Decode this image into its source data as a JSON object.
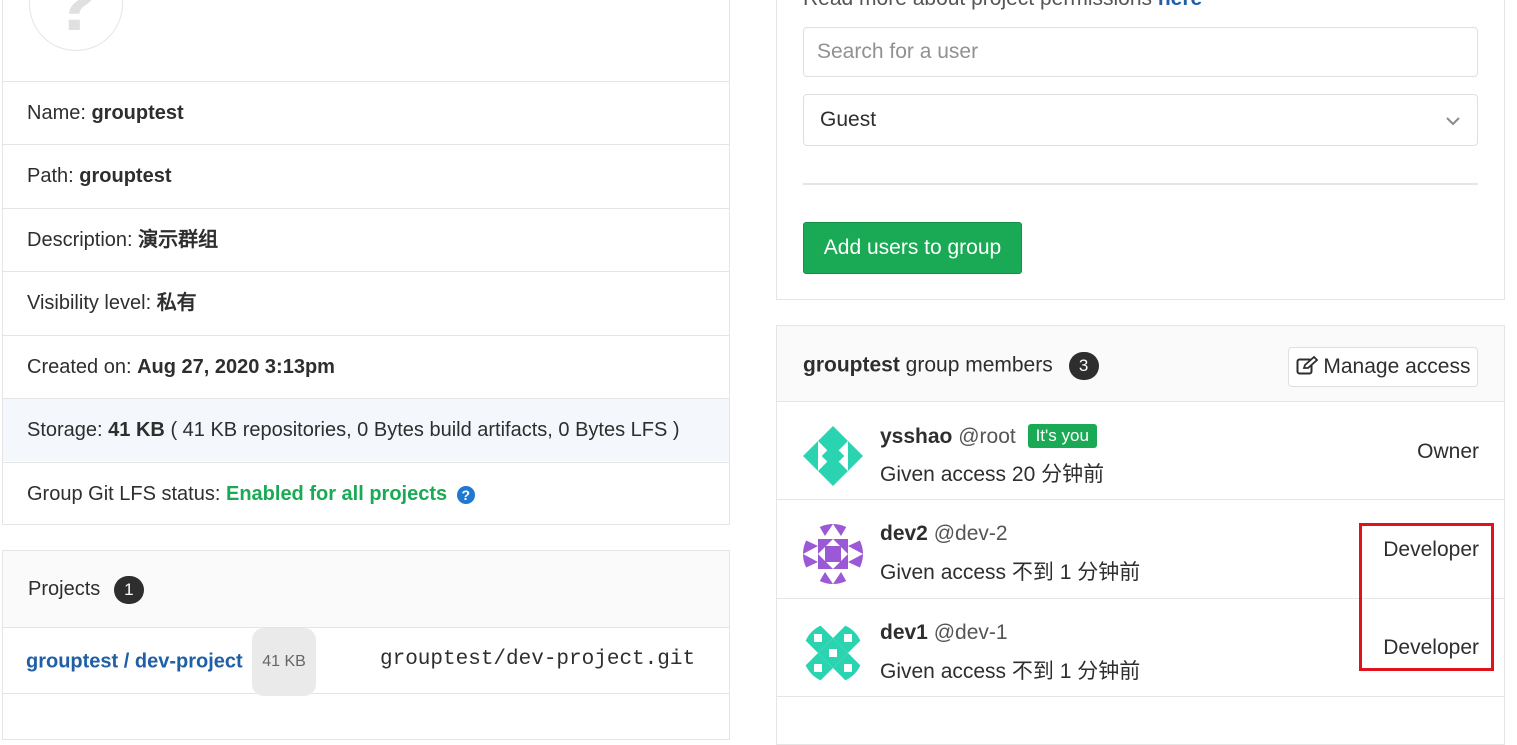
{
  "group_info": {
    "name_label": "Name:",
    "name_value": "grouptest",
    "path_label": "Path:",
    "path_value": "grouptest",
    "description_label": "Description:",
    "description_value": "演示群组",
    "visibility_label": "Visibility level:",
    "visibility_value": "私有",
    "created_label": "Created on:",
    "created_value": "Aug 27, 2020 3:13pm",
    "storage_label": "Storage:",
    "storage_value": "41 KB",
    "storage_detail": "( 41 KB repositories, 0 Bytes build artifacts, 0 Bytes LFS )",
    "lfs_label": "Group Git LFS status:",
    "lfs_value": "Enabled for all projects"
  },
  "projects": {
    "title": "Projects",
    "count": "1",
    "items": [
      {
        "name": "grouptest / dev-project",
        "size": "41 KB",
        "git_path": "grouptest/dev-project.git"
      }
    ]
  },
  "add_member": {
    "permissions_text": "Read more about project permissions",
    "permissions_link": "here",
    "search_placeholder": "Search for a user",
    "role_selected": "Guest",
    "submit_label": "Add users to group"
  },
  "members": {
    "group_name": "grouptest",
    "title_suffix": "group members",
    "count": "3",
    "manage_label": "Manage access",
    "list": [
      {
        "name": "ysshao",
        "username": "@root",
        "badge": "It's you",
        "access": "Given access 20 分钟前",
        "role": "Owner",
        "avatar_color": "#2ad4b0"
      },
      {
        "name": "dev2",
        "username": "@dev-2",
        "access": "Given access 不到 1 分钟前",
        "role": "Developer",
        "avatar_color": "#9b59d6"
      },
      {
        "name": "dev1",
        "username": "@dev-1",
        "access": "Given access 不到 1 分钟前",
        "role": "Developer",
        "avatar_color": "#2ad4b0"
      }
    ]
  },
  "icons": {
    "help": "question-circle-icon",
    "edit": "pencil-square-icon",
    "dropdown": "chevron-down-icon"
  },
  "colors": {
    "green": "#1aaa55",
    "link": "#1f5fa6",
    "highlight": "#e0131d"
  }
}
